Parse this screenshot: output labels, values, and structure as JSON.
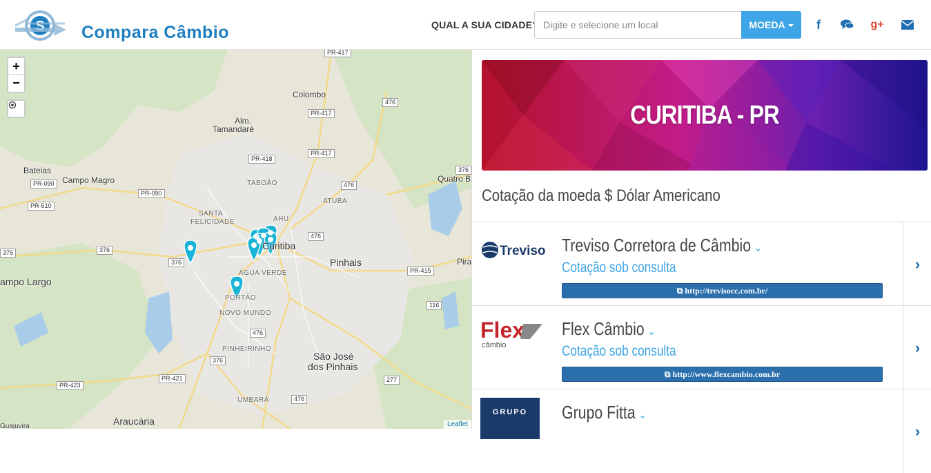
{
  "header": {
    "logo_text": "Compara Câmbio",
    "city_label": "QUAL A SUA CIDADE?",
    "search_placeholder": "Digite e selecione um local",
    "moeda_label": "MOEDA",
    "social": [
      "facebook-icon",
      "chat-icon",
      "google-plus-icon",
      "mail-icon"
    ],
    "colors": {
      "brand": "#1f7fc1",
      "accent": "#3ea5e6"
    }
  },
  "map": {
    "zoom_in": "+",
    "zoom_out": "−",
    "attribution": "Leaflet",
    "labels": {
      "colombo": "Colombo",
      "almirante": "Alm.",
      "tamandare": "Tamandaré",
      "bateias": "Bateias",
      "campo_magro": "Campo Magro",
      "santa": "SANTA",
      "felicidade": "FELICIDADE",
      "taboao": "TABOÃO",
      "ahu": "AHU",
      "atuba": "ATUBA",
      "curitiba": "Curitiba",
      "pinhais": "Pinhais",
      "agua_verde": "ÁGUA VERDE",
      "portao": "PORTÃO",
      "novo_mundo": "NOVO MUNDO",
      "pinheirinho": "PINHEIRINHO",
      "sao_jose": "São José",
      "dos_pinhais": "dos Pinhais",
      "umbara": "UMBARÁ",
      "araucaria": "Araucária",
      "campo_largo": "ampo Largo",
      "quatro_barras": "Quatro Bar",
      "piraquara": "Pira",
      "guajuvira": "Guajuvira"
    },
    "roads": {
      "pr417a": "PR-417",
      "pr417b": "PR-417",
      "pr417c": "PR-417",
      "pr418": "PR-418",
      "r476a": "476",
      "r476b": "476",
      "r476c": "476",
      "r476d": "476",
      "r476e": "476",
      "pr090a": "PR-090",
      "pr090b": "PR-090",
      "pr510": "PR-510",
      "r376a": "376",
      "r376b": "376",
      "r376c": "376",
      "r376d": "376",
      "r376e": "376",
      "pr415": "PR-415",
      "r116": "116",
      "r277": "277",
      "pr421": "PR-421",
      "pr423": "PR-423"
    }
  },
  "banner": {
    "title": "CURITIBA - PR"
  },
  "section_title": "Cotação da moeda $ Dólar Americano",
  "exchanges": [
    {
      "name": "Treviso Corretora de Câmbio",
      "quote": "Cotação sob consulta",
      "url": "http://trevisocc.com.br/",
      "logo": "Treviso"
    },
    {
      "name": "Flex Câmbio",
      "quote": "Cotação sob consulta",
      "url": "http://www.flexcambio.com.br",
      "logo": "Flex",
      "logo_sub": "câmbio"
    },
    {
      "name": "Grupo Fitta",
      "quote": "",
      "url": "",
      "logo": "GRUPO"
    }
  ]
}
